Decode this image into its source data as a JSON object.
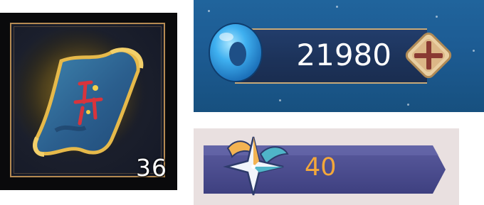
{
  "item_slot": {
    "icon": "magic-carpet-icon",
    "count": "36",
    "frame_color": "#b58a52"
  },
  "currency": {
    "icon": "blue-ring-gem-icon",
    "value": "21980",
    "add_icon": "plus-icon"
  },
  "badge": {
    "icon": "winged-star-icon",
    "value": "40",
    "value_color": "#f4a83a"
  }
}
